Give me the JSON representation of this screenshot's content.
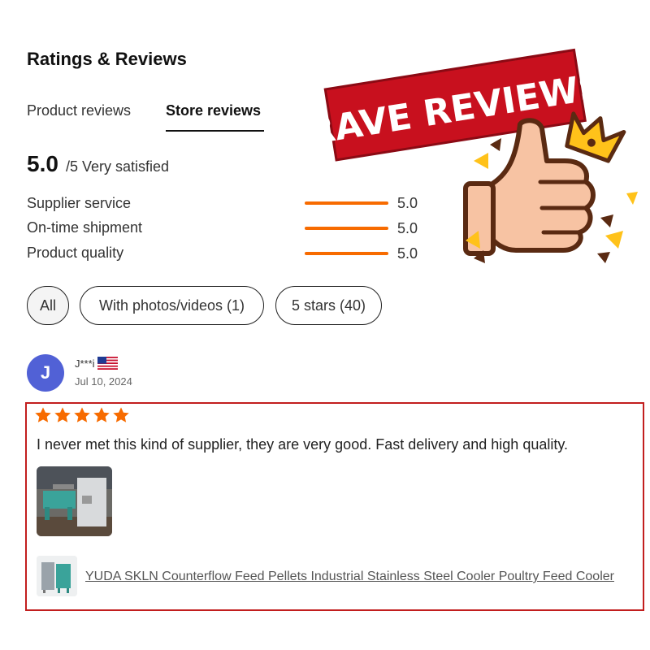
{
  "header": {
    "title": "Ratings & Reviews"
  },
  "tabs": [
    {
      "label": "Product reviews"
    },
    {
      "label": "Store reviews"
    }
  ],
  "summary": {
    "score": "5.0",
    "suffix": "/5 Very satisfied"
  },
  "metrics": [
    {
      "label": "Supplier service",
      "value": "5.0",
      "fill": 1.0
    },
    {
      "label": "On-time shipment",
      "value": "5.0",
      "fill": 1.0
    },
    {
      "label": "Product quality",
      "value": "5.0",
      "fill": 1.0
    }
  ],
  "filters": [
    {
      "label": "All"
    },
    {
      "label": "With photos/videos (1)"
    },
    {
      "label": "5 stars (40)"
    }
  ],
  "review": {
    "avatar_letter": "J",
    "name": "J***i",
    "date": "Jul 10, 2024",
    "rating": 5,
    "text": "I never met this kind of supplier, they are very good. Fast delivery and high quality.",
    "product_link": "YUDA SKLN Counterflow Feed Pellets Industrial Stainless Steel Cooler Poultry Feed Cooler"
  },
  "promo": {
    "banner_text": "RAVE REVIEWS"
  },
  "colors": {
    "accent": "#f76b00",
    "avatar": "#5161d6",
    "highlight_border": "#c21e1e",
    "banner": "#c8101e"
  }
}
